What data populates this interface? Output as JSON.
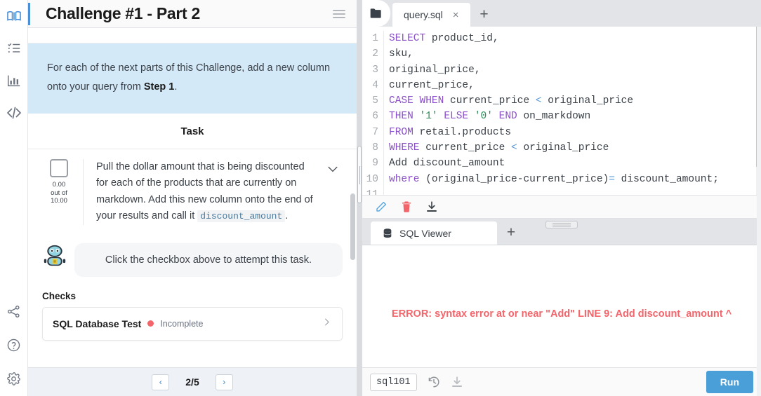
{
  "rail": {
    "top_items": [
      {
        "name": "book-icon",
        "label": "Lessons",
        "active": true
      },
      {
        "name": "checklist-icon",
        "label": "Tasks",
        "active": false
      },
      {
        "name": "bar-chart-icon",
        "label": "Progress",
        "active": false
      },
      {
        "name": "code-icon",
        "label": "Code",
        "active": false
      }
    ],
    "bottom_items": [
      {
        "name": "share-icon",
        "label": "Share"
      },
      {
        "name": "help-icon",
        "label": "Help"
      },
      {
        "name": "settings-icon",
        "label": "Settings"
      }
    ]
  },
  "left_panel": {
    "title": "Challenge #1 - Part 2",
    "menu_label": "Menu",
    "callout": {
      "text_before": "For each of the next parts of this Challenge, add a new column onto your query from ",
      "bold": "Step 1",
      "text_after": ".",
      "bg_color": "#d4e9f7"
    },
    "task_header": "Task",
    "task": {
      "checkbox_checked": false,
      "score": "0.00 out of 10.00",
      "score_line1": "0.00",
      "score_line2": "out of",
      "score_line3": "10.00",
      "text_before": "Pull the dollar amount that is being discounted for each of the products that are currently on markdown. Add this new column onto the end of your results and call it ",
      "code_chip": "discount_amount",
      "text_after": ".",
      "collapse_icon": "chevron-down-icon"
    },
    "bot_message": "Click the checkbox above to attempt this task.",
    "checks_label": "Checks",
    "checks": [
      {
        "name": "SQL Database Test",
        "status": "Incomplete",
        "status_color": "#f2656a"
      }
    ],
    "pager": {
      "prev": "‹",
      "next": "›",
      "count": "2/5"
    }
  },
  "right_panel": {
    "editor_tabs": [
      {
        "label": "query.sql",
        "active": true,
        "close": "×"
      }
    ],
    "new_tab_label": "+",
    "folder_icon": "folder-icon",
    "code": {
      "lines": [
        {
          "num": "1",
          "tokens": [
            {
              "t": "SELECT",
              "c": "kw"
            },
            {
              "t": " product_id,",
              "c": ""
            }
          ]
        },
        {
          "num": "2",
          "tokens": [
            {
              "t": "sku,",
              "c": ""
            }
          ]
        },
        {
          "num": "3",
          "tokens": [
            {
              "t": "original_price,",
              "c": ""
            }
          ]
        },
        {
          "num": "4",
          "tokens": [
            {
              "t": "current_price,",
              "c": ""
            }
          ]
        },
        {
          "num": "5",
          "tokens": [
            {
              "t": "CASE",
              "c": "kw"
            },
            {
              "t": " ",
              "c": ""
            },
            {
              "t": "WHEN",
              "c": "kw"
            },
            {
              "t": " current_price ",
              "c": ""
            },
            {
              "t": "<",
              "c": "op"
            },
            {
              "t": " original_price",
              "c": ""
            }
          ]
        },
        {
          "num": "6",
          "tokens": [
            {
              "t": "THEN",
              "c": "kw"
            },
            {
              "t": " ",
              "c": ""
            },
            {
              "t": "'1'",
              "c": "str"
            },
            {
              "t": " ",
              "c": ""
            },
            {
              "t": "ELSE",
              "c": "kw"
            },
            {
              "t": " ",
              "c": ""
            },
            {
              "t": "'0'",
              "c": "str"
            },
            {
              "t": " ",
              "c": ""
            },
            {
              "t": "END",
              "c": "kw"
            },
            {
              "t": " on_markdown",
              "c": ""
            }
          ]
        },
        {
          "num": "7",
          "tokens": [
            {
              "t": "FROM",
              "c": "kw"
            },
            {
              "t": " retail.products",
              "c": ""
            }
          ]
        },
        {
          "num": "8",
          "tokens": [
            {
              "t": "WHERE",
              "c": "kw"
            },
            {
              "t": " current_price ",
              "c": ""
            },
            {
              "t": "<",
              "c": "op"
            },
            {
              "t": " original_price",
              "c": ""
            }
          ]
        },
        {
          "num": "9",
          "tokens": [
            {
              "t": "Add discount_amount",
              "c": ""
            }
          ]
        },
        {
          "num": "10",
          "tokens": [
            {
              "t": "where",
              "c": "kw"
            },
            {
              "t": " (original_price-current_price)",
              "c": ""
            },
            {
              "t": "=",
              "c": "op"
            },
            {
              "t": " discount_amount;",
              "c": ""
            }
          ]
        },
        {
          "num": "11",
          "tokens": [
            {
              "t": "",
              "c": ""
            }
          ]
        }
      ],
      "full_text": "SELECT product_id,\nsku,\noriginal_price,\ncurrent_price,\nCASE WHEN current_price < original_price\nTHEN '1' ELSE '0' END on_markdown\nFROM retail.products\nWHERE current_price < original_price\nAdd discount_amount\nwhere (original_price-current_price)= discount_amount;\n"
    },
    "editor_toolbar": [
      {
        "name": "edit-pencil-icon",
        "label": "Edit",
        "color": "#5aa7e0"
      },
      {
        "name": "delete-trash-icon",
        "label": "Delete",
        "color": "#f2656a"
      },
      {
        "name": "download-icon",
        "label": "Download",
        "color": "#3b4148"
      }
    ],
    "viewer_tabs": [
      {
        "label": "SQL Viewer",
        "icon": "database-icon",
        "active": true
      }
    ],
    "viewer_new_tab_label": "+",
    "resize_handle": "panel-resize-handle",
    "result": {
      "error": "ERROR: syntax error at or near \"Add\" LINE 9: Add discount_amount ^",
      "error_color": "#f2656a"
    },
    "statusbar": {
      "database": "sql101",
      "history_icon": "history-icon",
      "download_icon": "download-icon",
      "run_label": "Run",
      "run_color": "#4a9fd8"
    }
  }
}
